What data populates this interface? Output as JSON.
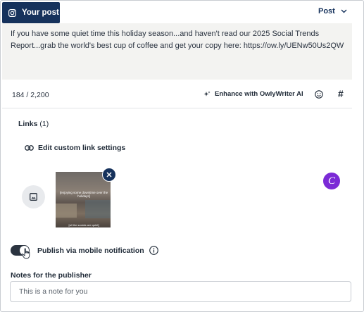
{
  "tab": {
    "label": "Your post",
    "icon": "instagram-icon"
  },
  "post_dropdown": {
    "label": "Post",
    "icon": "chevron-down-icon"
  },
  "composer": {
    "text": "If you have some quiet time this holiday season...and haven't read our 2025 Social Trends Report...grab the world's best cup of coffee and get your copy here: https://ow.ly/UENw50Us2QW",
    "char_count": "184 / 2,200"
  },
  "toolbar": {
    "enhance_label": "Enhance with OwlyWriter AI",
    "enhance_icon": "sparkle-icon",
    "emoji_icon": "smiley-icon",
    "hashtag_label": "#"
  },
  "links": {
    "label": "Links",
    "count": "(1)",
    "edit_label": "Edit custom link settings",
    "edit_icon": "link-icon"
  },
  "media": {
    "add_icon": "image-icon",
    "thumbnail_caption": "[enjoying some downtime over the holidays]",
    "thumbnail_subcaption": "[all the socials are quiet]",
    "remove_icon": "close-icon"
  },
  "avatar": {
    "letter": "C",
    "color": "#7b2ad6"
  },
  "publish_toggle": {
    "label": "Publish via mobile notification",
    "enabled": true,
    "info_icon": "info-icon"
  },
  "notes": {
    "label": "Notes for the publisher",
    "value": "This is a note for you"
  },
  "colors": {
    "navy": "#16325c",
    "avatar": "#7b2ad6",
    "textarea_bg": "#f3f3f1"
  }
}
